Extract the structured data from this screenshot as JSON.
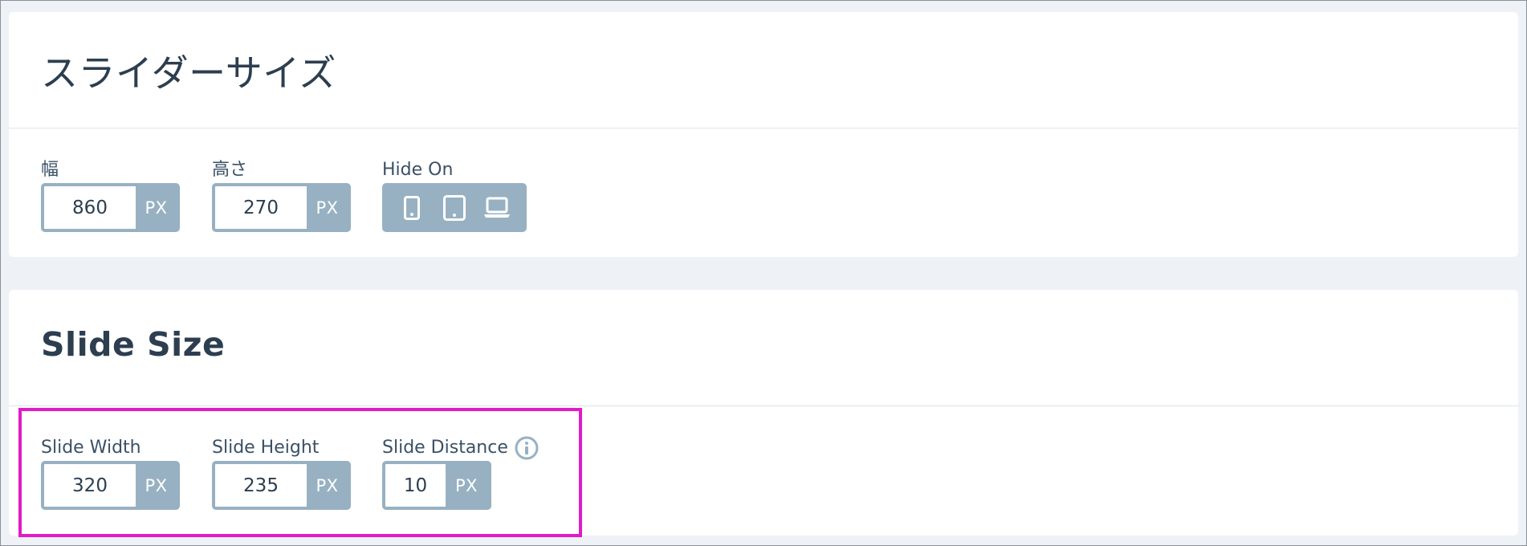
{
  "slider_size": {
    "title": "スライダーサイズ",
    "width": {
      "label": "幅",
      "value": "860",
      "unit": "PX"
    },
    "height": {
      "label": "高さ",
      "value": "270",
      "unit": "PX"
    },
    "hide_on": {
      "label": "Hide On",
      "devices": [
        "mobile-icon",
        "tablet-icon",
        "laptop-icon"
      ]
    }
  },
  "slide_size": {
    "title": "Slide Size",
    "width": {
      "label": "Slide Width",
      "value": "320",
      "unit": "PX"
    },
    "height": {
      "label": "Slide Height",
      "value": "235",
      "unit": "PX"
    },
    "distance": {
      "label": "Slide Distance",
      "value": "10",
      "unit": "PX",
      "info_icon": "info-icon"
    }
  },
  "colors": {
    "accent": "#97b1c2",
    "text": "#2c3e50",
    "highlight": "#e01bc7",
    "background": "#eef2f6"
  }
}
